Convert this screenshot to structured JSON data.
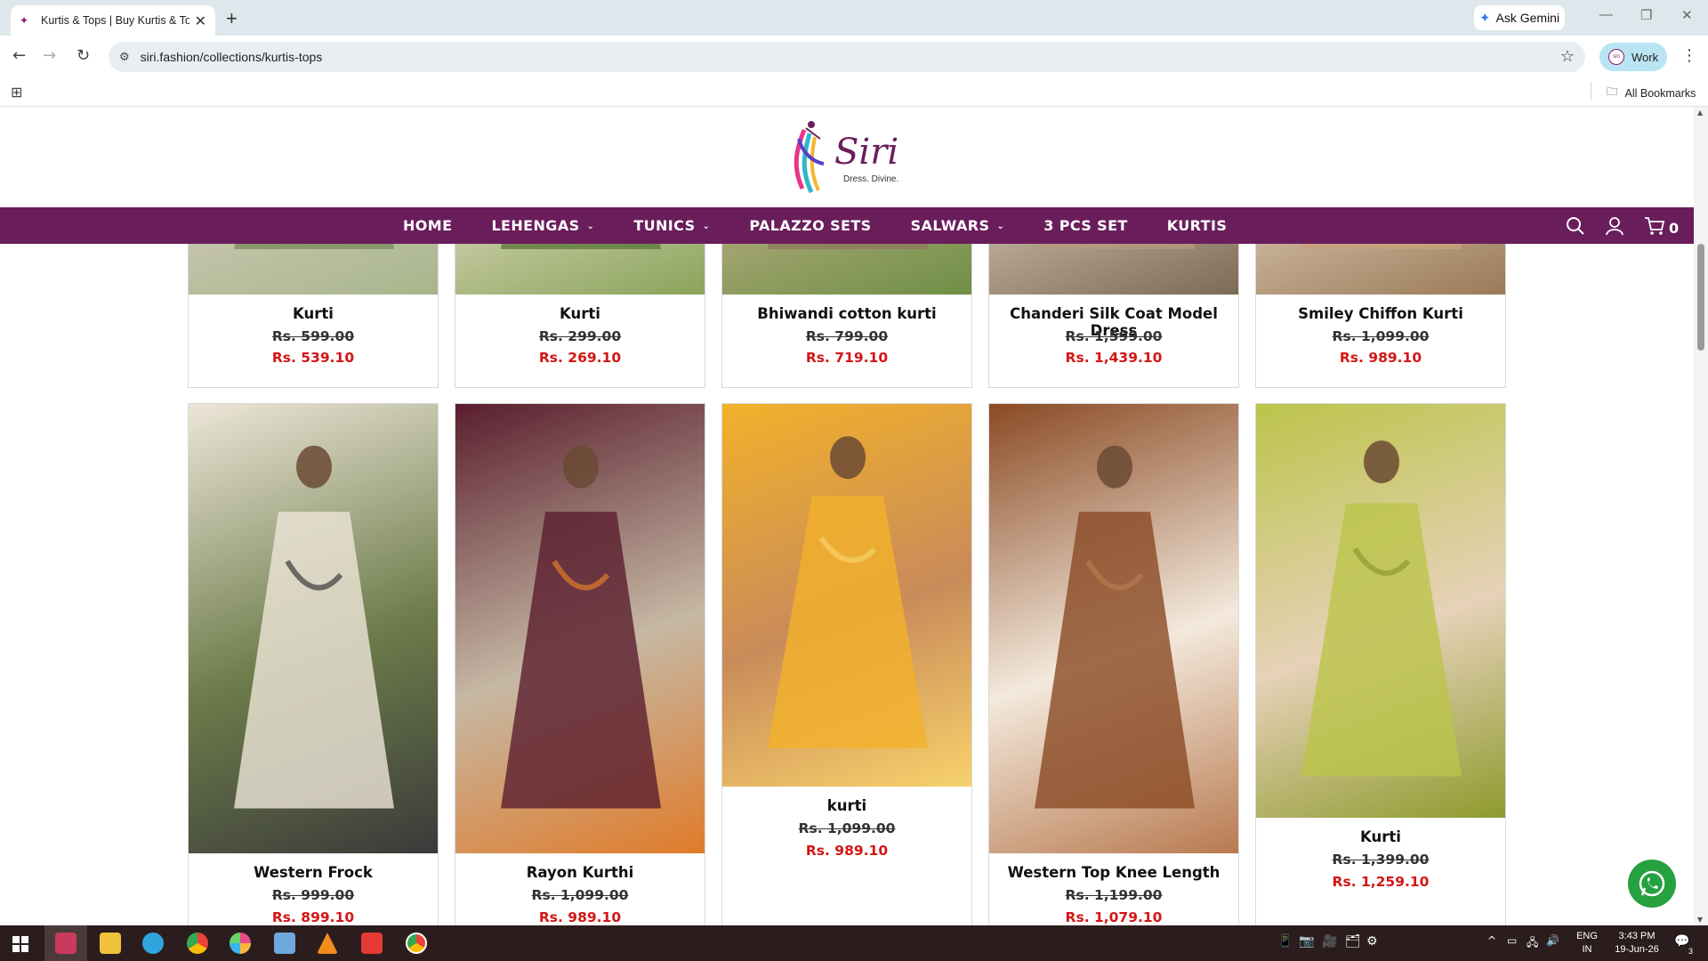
{
  "browser": {
    "tab_title": "Kurtis & Tops | Buy Kurtis & Tops",
    "new_tab": "+",
    "ask_gemini": "Ask Gemini",
    "url": "siri.fashion/collections/kurtis-tops",
    "profile_label": "Work",
    "all_bookmarks": "All Bookmarks"
  },
  "site": {
    "logo_text": "Siri",
    "tagline": "Dress. Divine.",
    "brand_color": "#6a1d5b",
    "nav": [
      {
        "label": "HOME",
        "dropdown": false
      },
      {
        "label": "LEHENGAS",
        "dropdown": true
      },
      {
        "label": "TUNICS",
        "dropdown": true
      },
      {
        "label": "PALAZZO SETS",
        "dropdown": false
      },
      {
        "label": "SALWARS",
        "dropdown": true
      },
      {
        "label": "3 PCS SET",
        "dropdown": false
      },
      {
        "label": "KURTIS",
        "dropdown": false
      }
    ],
    "cart_count": "0"
  },
  "products_row1": [
    {
      "name": "Kurti",
      "old_price": "Rs. 599.00",
      "new_price": "Rs. 539.10"
    },
    {
      "name": "Kurti",
      "old_price": "Rs. 299.00",
      "new_price": "Rs. 269.10"
    },
    {
      "name": "Bhiwandi cotton kurti",
      "old_price": "Rs. 799.00",
      "new_price": "Rs. 719.10"
    },
    {
      "name": "Chanderi Silk Coat Model Dress",
      "old_price": "Rs. 1,599.00",
      "new_price": "Rs. 1,439.10"
    },
    {
      "name": "Smiley Chiffon Kurti",
      "old_price": "Rs. 1,099.00",
      "new_price": "Rs. 989.10"
    }
  ],
  "products_row2": [
    {
      "name": "Western Frock",
      "old_price": "Rs. 999.00",
      "new_price": "Rs. 899.10"
    },
    {
      "name": "Rayon Kurthi",
      "old_price": "Rs. 1,099.00",
      "new_price": "Rs. 989.10"
    },
    {
      "name": "kurti",
      "old_price": "Rs. 1,099.00",
      "new_price": "Rs. 989.10"
    },
    {
      "name": "Western Top Knee Length",
      "old_price": "Rs. 1,199.00",
      "new_price": "Rs. 1,079.10"
    },
    {
      "name": "Kurti",
      "old_price": "Rs. 1,399.00",
      "new_price": "Rs. 1,259.10"
    }
  ],
  "taskbar": {
    "lang": "ENG",
    "region": "IN",
    "time": "3:43 PM",
    "date": "19-Jun-26",
    "notifications": "3"
  }
}
